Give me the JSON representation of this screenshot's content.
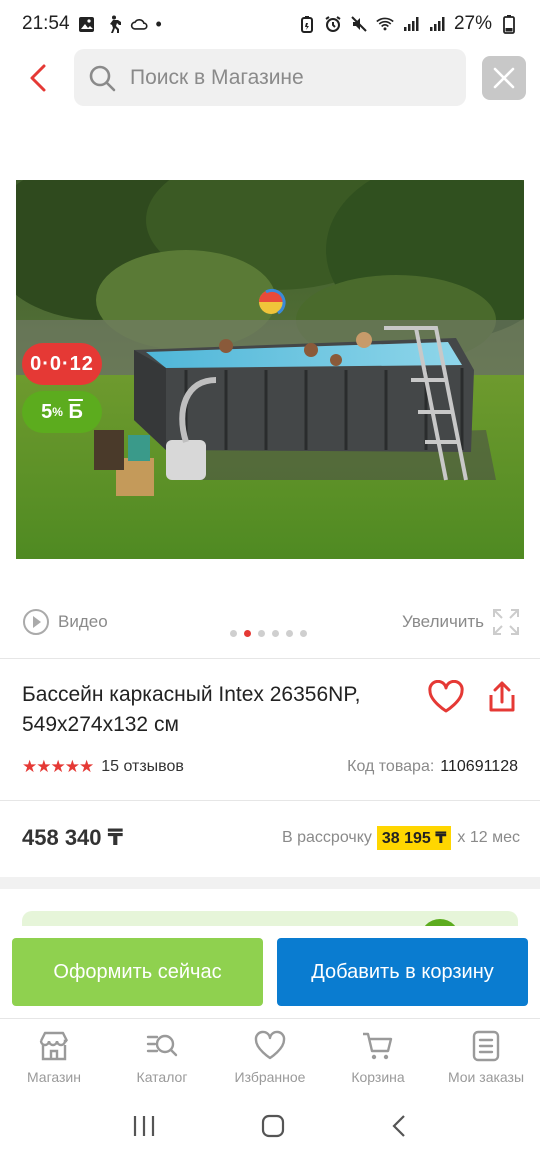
{
  "status_bar": {
    "time": "21:54",
    "battery": "27%"
  },
  "search": {
    "placeholder": "Поиск в Магазине"
  },
  "badges": {
    "installment": "0·0·12",
    "bonus_percent": "5",
    "bonus_suffix": "%",
    "bonus_letter": "Б"
  },
  "media": {
    "video_label": "Видео",
    "zoom_label": "Увеличить",
    "image_count": 6,
    "active_image_index": 1
  },
  "product": {
    "title": "Бассейн каркасный Intex 26356NP, 549x274x132 см",
    "rating": 5,
    "reviews": "15 отзывов",
    "code_label": "Код товара:",
    "code_value": "110691128",
    "price": "458 340 ₸",
    "installment_label": "В рассрочку",
    "installment_amount": "38 195 ₸",
    "installment_term": "х 12 мес"
  },
  "actions": {
    "checkout": "Оформить сейчас",
    "add_to_cart": "Добавить в корзину"
  },
  "tabs": [
    {
      "label": "Магазин",
      "icon": "store-icon"
    },
    {
      "label": "Каталог",
      "icon": "catalog-search-icon"
    },
    {
      "label": "Избранное",
      "icon": "heart-icon"
    },
    {
      "label": "Корзина",
      "icon": "cart-icon"
    },
    {
      "label": "Мои заказы",
      "icon": "orders-icon"
    }
  ],
  "colors": {
    "accent_red": "#e53935",
    "bonus_green": "#5cac1e",
    "checkout_green": "#8fd14f",
    "cart_blue": "#0a7cd0",
    "installment_yellow": "#ffd600"
  }
}
